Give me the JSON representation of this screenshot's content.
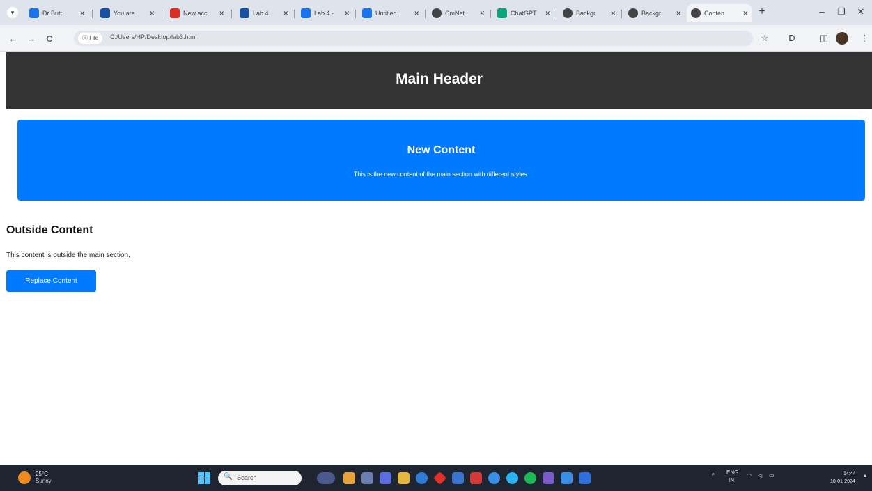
{
  "browser": {
    "tabs": [
      {
        "label": "Dr Butt",
        "fav_color": "#1a73e8"
      },
      {
        "label": "You are",
        "fav_color": "#1a4fa0"
      },
      {
        "label": "New acc",
        "fav_color": "#d93025"
      },
      {
        "label": "Lab 4",
        "fav_color": "#1a4fa0"
      },
      {
        "label": "Lab 4 -",
        "fav_color": "#1a73e8"
      },
      {
        "label": "Untitled",
        "fav_color": "#1a73e8"
      },
      {
        "label": "CmNet",
        "fav_color": "#444444"
      },
      {
        "label": "ChatGPT",
        "fav_color": "#10a37f"
      },
      {
        "label": "Backgr",
        "fav_color": "#444444"
      },
      {
        "label": "Backgr",
        "fav_color": "#444444"
      },
      {
        "label": "Conten",
        "fav_color": "#444444"
      }
    ],
    "tab_menu_glyph": "▾",
    "tab_close_glyph": "✕",
    "new_tab_glyph": "+",
    "window_controls": {
      "minimize": "–",
      "restore": "❐",
      "close": "✕"
    },
    "toolbar": {
      "back_glyph": "←",
      "forward_glyph": "→",
      "reload_glyph": "C",
      "site_chip": "ⓘ File",
      "url": "C:/Users/HP/Desktop/lab3.html",
      "bookmark_glyph": "☆",
      "extensions_glyph": "D",
      "sidepanel_glyph": "◫",
      "menu_glyph": "⋮"
    }
  },
  "page": {
    "header_title": "Main Header",
    "main_section": {
      "title": "New Content",
      "text": "This is the new content of the main section with different styles."
    },
    "outside": {
      "title": "Outside Content",
      "text": "This content is outside the main section.",
      "button_label": "Replace Content"
    },
    "colors": {
      "header_bg": "#333333",
      "main_bg": "#007bff",
      "button_bg": "#007bff"
    }
  },
  "taskbar": {
    "weather_temp": "25°C",
    "weather_condition": "Sunny",
    "search_placeholder": "Search",
    "search_glyph": "🔍",
    "apps": [
      "#4a5a8a",
      "#e8a33d",
      "#6a7fb0",
      "#5b6ee1",
      "#e6b73e",
      "#2f7cd6",
      "#e0302a",
      "#3a74d0",
      "#d23a3a",
      "#3b8ee8",
      "#2bb0f0",
      "#1db954",
      "#7a5cc7",
      "#3a8ee6",
      "#2f6fdc"
    ],
    "tray_lang": "ENG",
    "tray_region": "IN",
    "clock_time": "14:44",
    "clock_date": "18-01-2024"
  }
}
